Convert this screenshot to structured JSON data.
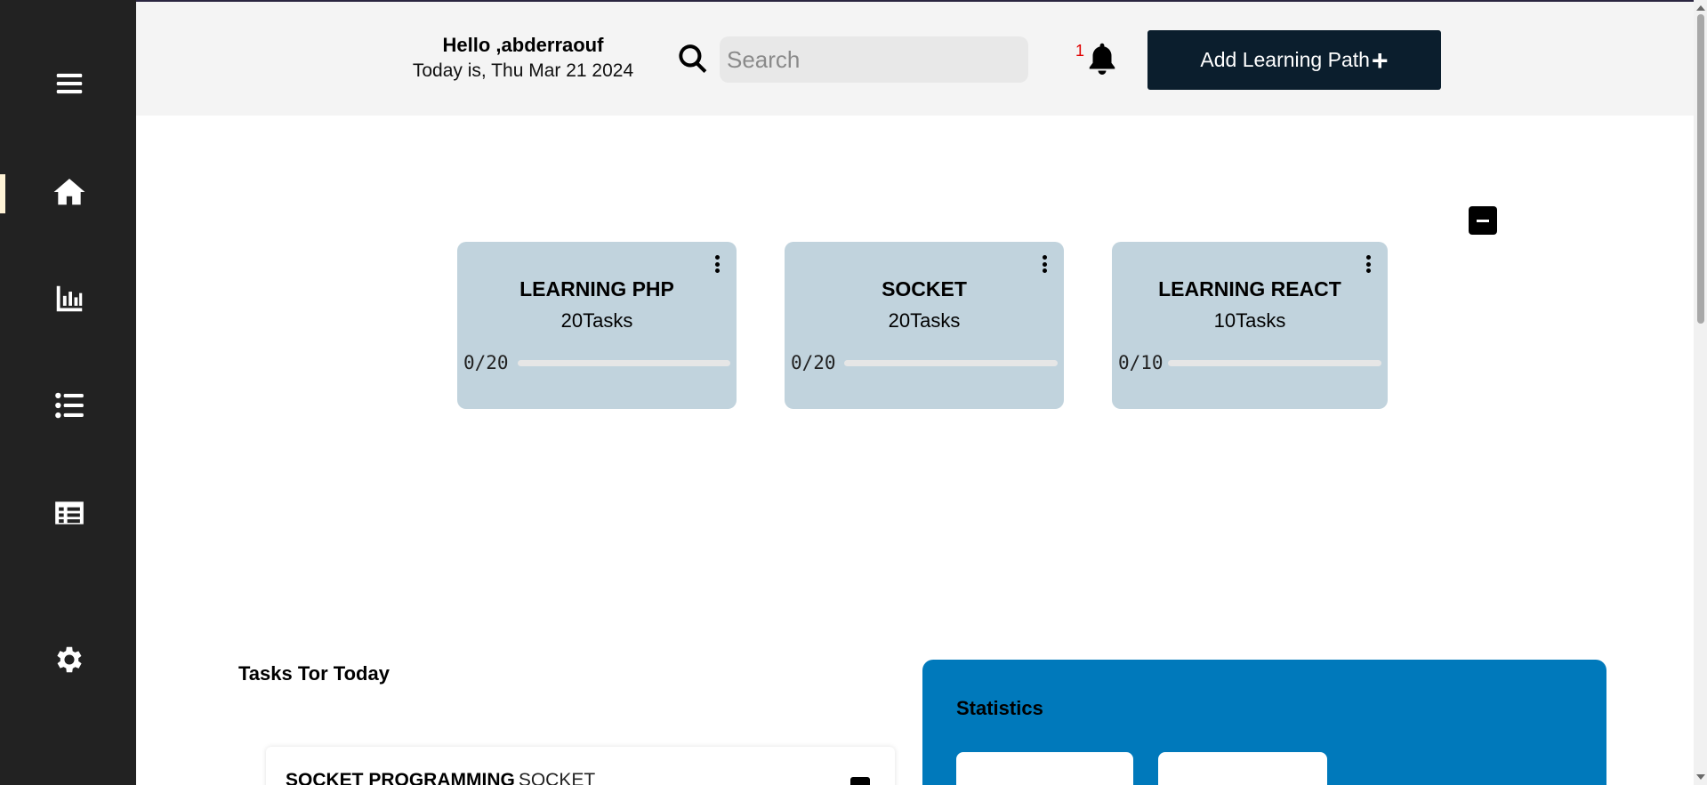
{
  "sidebar": {
    "items": [
      {
        "icon": "menu-icon"
      },
      {
        "icon": "home-icon",
        "active": true
      },
      {
        "icon": "chart-icon"
      },
      {
        "icon": "list-icon"
      },
      {
        "icon": "table-icon"
      },
      {
        "icon": "gear-icon"
      }
    ],
    "active_color": "#fff3d6",
    "background": "#222222"
  },
  "header": {
    "greeting": "Hello ,abderraouf",
    "date": "Today is, Thu Mar 21 2024",
    "search": {
      "placeholder": "Search",
      "value": ""
    },
    "notification_count": "1",
    "add_button_label": "Add Learning Path"
  },
  "learning_paths": [
    {
      "title": "LEARNING PHP",
      "tasks": "20Tasks",
      "progress_text": "0/20",
      "progress": 0
    },
    {
      "title": "SOCKET",
      "tasks": "20Tasks",
      "progress_text": "0/20",
      "progress": 0
    },
    {
      "title": "LEARNING REACT",
      "tasks": "10Tasks",
      "progress_text": "0/10",
      "progress": 0
    }
  ],
  "tasks_today": {
    "heading": "Tasks Tor Today",
    "items": [
      {
        "name": "SOCKET PROGRAMMING",
        "path": "SOCKET"
      }
    ]
  },
  "statistics": {
    "title": "Statistics",
    "color": "#0079bb"
  },
  "colors": {
    "accent_dark": "#0b1e2d",
    "card_bg": "#c1d3dd",
    "notification": "#e00000"
  }
}
